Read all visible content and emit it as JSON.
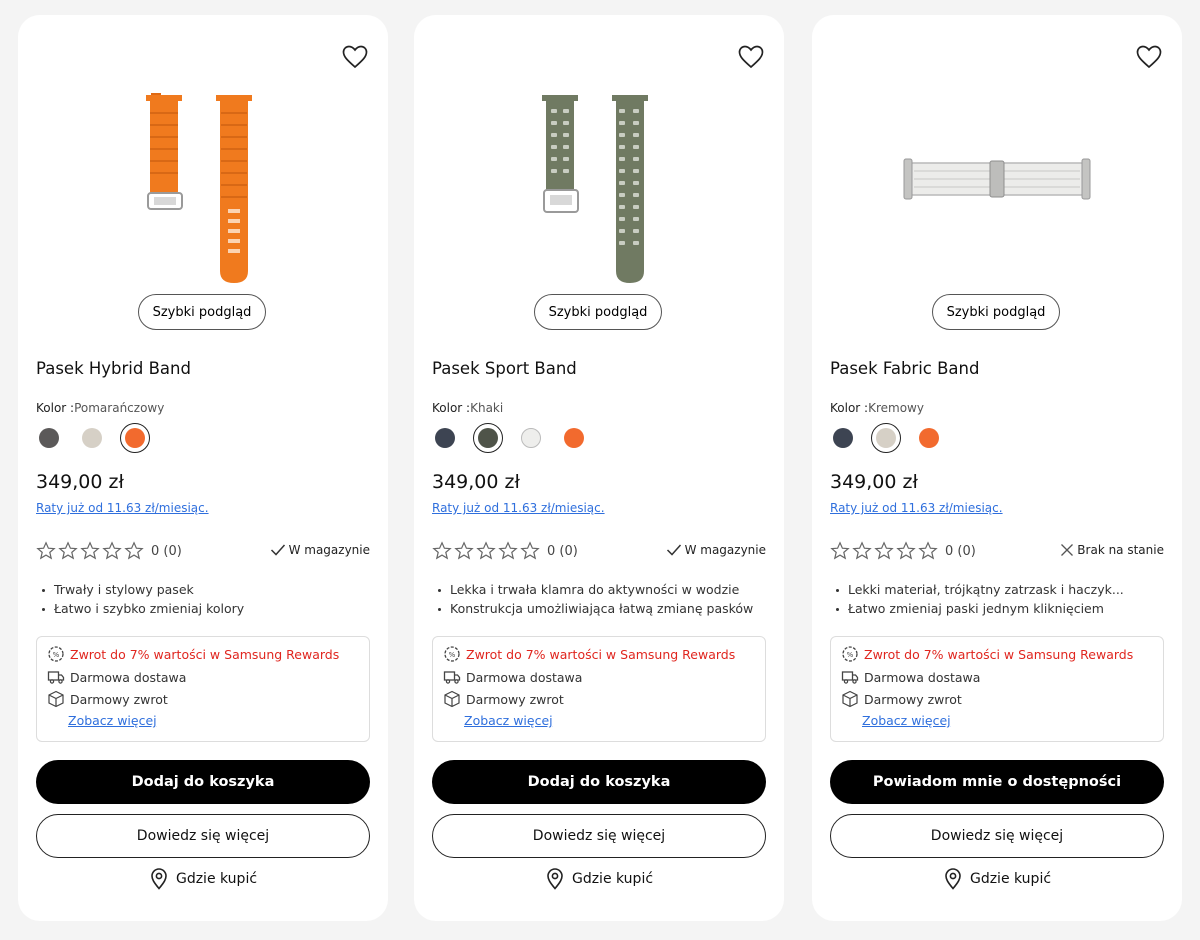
{
  "products": [
    {
      "title": "Pasek Hybrid Band",
      "quick_view": "Szybki podgląd",
      "color_label": "Kolor :",
      "color_value": "Pomarańczowy",
      "swatches": [
        "#5b5959",
        "#d6d0c6",
        "#f26a2e"
      ],
      "selected_swatch": 2,
      "price": "349,00 zł",
      "installment": "Raty już od 11.63 zł/miesiąc.",
      "rating_count": "0 (0)",
      "stock_status": "W magazynie",
      "stock_icon": "check-icon",
      "features": [
        "Trwały i stylowy pasek",
        "Łatwo i szybko zmieniaj kolory"
      ],
      "benefits": [
        "Zwrot do 7% wartości w Samsung Rewards",
        "Darmowa dostawa",
        "Darmowy zwrot"
      ],
      "more_link": "Zobacz więcej",
      "primary_btn": "Dodaj do koszyka",
      "secondary_btn": "Dowiedz się więcej",
      "where_buy": "Gdzie kupić",
      "band_color": "#f07a1e"
    },
    {
      "title": "Pasek Sport Band",
      "quick_view": "Szybki podgląd",
      "color_label": "Kolor :",
      "color_value": "Khaki",
      "swatches": [
        "#3d4452",
        "#4f5449",
        "#eeeeec",
        "#f26a2e"
      ],
      "selected_swatch": 1,
      "price": "349,00 zł",
      "installment": "Raty już od 11.63 zł/miesiąc.",
      "rating_count": "0 (0)",
      "stock_status": "W magazynie",
      "stock_icon": "check-icon",
      "features": [
        "Lekka i trwała klamra do aktywności w wodzie",
        "Konstrukcja umożliwiająca łatwą zmianę pasków"
      ],
      "benefits": [
        "Zwrot do 7% wartości w Samsung Rewards",
        "Darmowa dostawa",
        "Darmowy zwrot"
      ],
      "more_link": "Zobacz więcej",
      "primary_btn": "Dodaj do koszyka",
      "secondary_btn": "Dowiedz się więcej",
      "where_buy": "Gdzie kupić",
      "band_color": "#707a62"
    },
    {
      "title": "Pasek Fabric Band",
      "quick_view": "Szybki podgląd",
      "color_label": "Kolor :",
      "color_value": "Kremowy",
      "swatches": [
        "#3d4452",
        "#d6d0c6",
        "#f26a2e"
      ],
      "selected_swatch": 1,
      "price": "349,00 zł",
      "installment": "Raty już od 11.63 zł/miesiąc.",
      "rating_count": "0 (0)",
      "stock_status": "Brak na stanie",
      "stock_icon": "x-icon",
      "features": [
        "Lekki materiał, trójkątny zatrzask i haczyk...",
        "Łatwo zmieniaj paski jednym kliknięciem"
      ],
      "benefits": [
        "Zwrot do 7% wartości w Samsung Rewards",
        "Darmowa dostawa",
        "Darmowy zwrot"
      ],
      "more_link": "Zobacz więcej",
      "primary_btn": "Powiadom mnie o dostępności",
      "secondary_btn": "Dowiedz się więcej",
      "where_buy": "Gdzie kupić",
      "band_color": "#e4e4e2"
    }
  ]
}
